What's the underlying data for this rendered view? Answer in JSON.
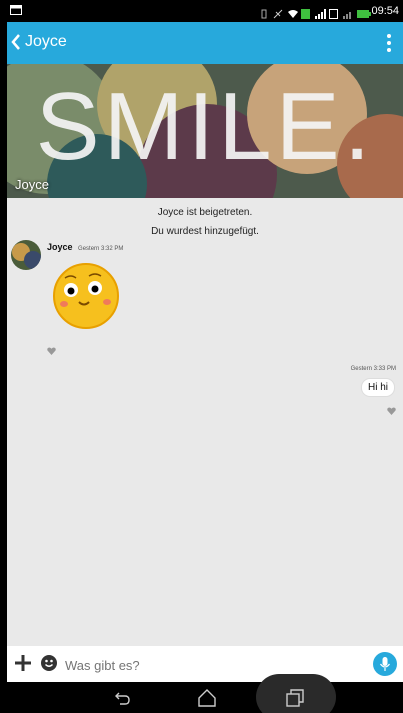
{
  "statusbar": {
    "time": "09:54"
  },
  "header": {
    "title": "Joyce",
    "back_icon": "chevron-left-icon",
    "menu_icon": "overflow-menu-icon"
  },
  "banner": {
    "text": "SMILE.",
    "name": "Joyce"
  },
  "messages": {
    "system_1": "Joyce ist beigetreten.",
    "system_2": "Du wurdest hinzugefügt.",
    "incoming": {
      "sender": "Joyce",
      "time": "Gestern 3:32 PM",
      "sticker": "smiley-sticker"
    },
    "outgoing": {
      "time": "Gestern 3:33 PM",
      "text": "Hi hi"
    }
  },
  "composer": {
    "placeholder": "Was gibt es?"
  },
  "colors": {
    "accent": "#27a9dc",
    "chat_bg": "#e9e9e9"
  }
}
